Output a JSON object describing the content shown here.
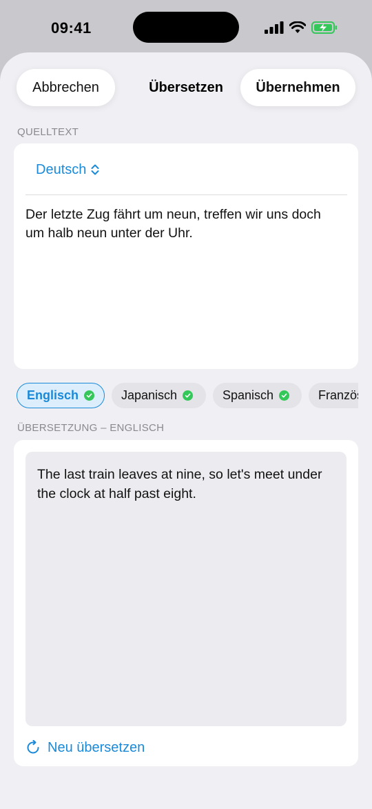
{
  "status": {
    "time": "09:41"
  },
  "nav": {
    "cancel_label": "Abbrechen",
    "title": "Übersetzen",
    "apply_label": "Übernehmen"
  },
  "source": {
    "section_label": "QUELLTEXT",
    "language": "Deutsch",
    "text": "Der letzte Zug fährt um neun, treffen wir uns doch um halb neun unter der Uhr."
  },
  "languages": [
    {
      "label": "Englisch",
      "selected": true,
      "done": true
    },
    {
      "label": "Japanisch",
      "selected": false,
      "done": true
    },
    {
      "label": "Spanisch",
      "selected": false,
      "done": true
    },
    {
      "label": "Französisch",
      "selected": false,
      "done": false
    }
  ],
  "translation": {
    "section_label": "ÜBERSETZUNG – ENGLISCH",
    "text": "The last train leaves at nine, so let's meet under the clock at half past eight.",
    "retranslate_label": "Neu übersetzen"
  },
  "colors": {
    "accent": "#1a8ad8",
    "check": "#34c759",
    "battery": "#34c759"
  },
  "icons": {
    "language_picker": "chevron-up-down-icon",
    "retranslate": "refresh-icon"
  }
}
